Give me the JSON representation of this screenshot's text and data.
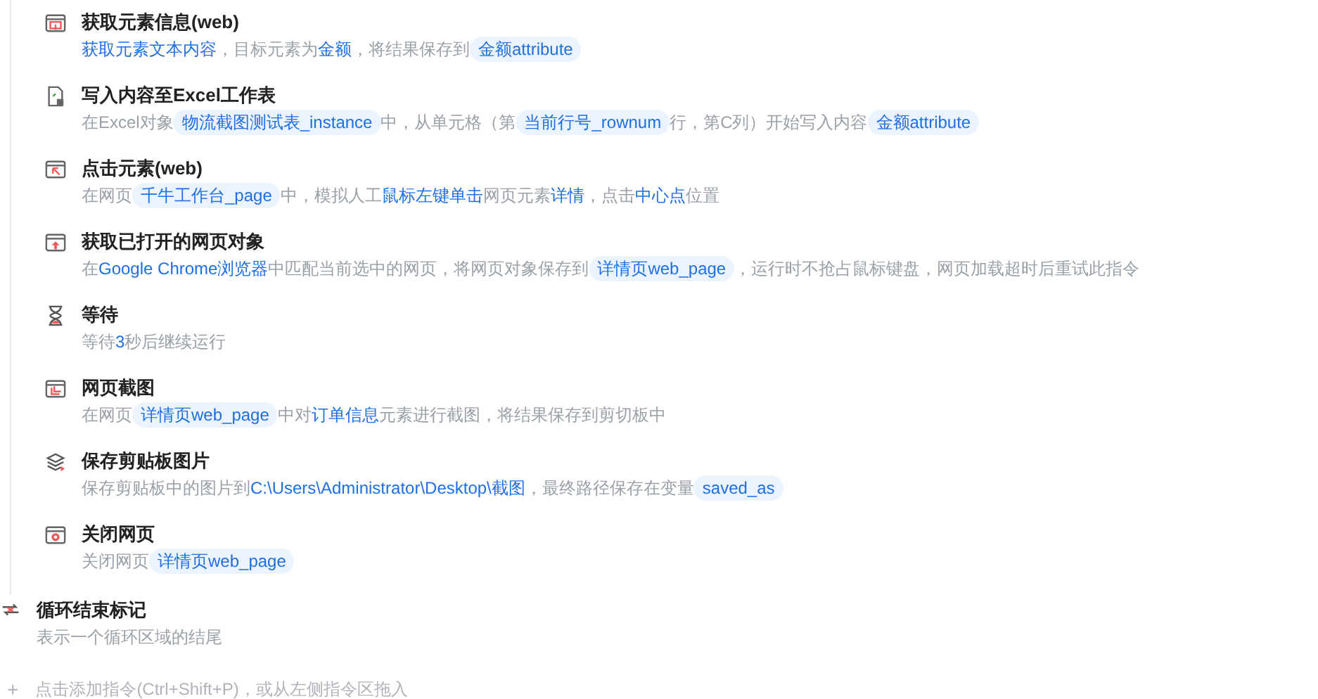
{
  "steps": [
    {
      "kind": "get-element",
      "title": "获取元素信息(web)",
      "description": [
        {
          "kind": "link",
          "text": "获取元素文本内容"
        },
        {
          "kind": "text",
          "text": "，目标元素为"
        },
        {
          "kind": "link",
          "text": "金额"
        },
        {
          "kind": "text",
          "text": "，将结果保存到"
        },
        {
          "kind": "chip",
          "text": "金额attribute"
        }
      ]
    },
    {
      "kind": "write-excel",
      "title": "写入内容至Excel工作表",
      "description": [
        {
          "kind": "text",
          "text": "在Excel对象"
        },
        {
          "kind": "chip",
          "text": "物流截图测试表_instance"
        },
        {
          "kind": "text",
          "text": "中，从单元格（第"
        },
        {
          "kind": "chip",
          "text": "当前行号_rownum"
        },
        {
          "kind": "text",
          "text": "行，第C列）开始写入内容"
        },
        {
          "kind": "chip",
          "text": "金额attribute"
        }
      ]
    },
    {
      "kind": "click-element",
      "title": "点击元素(web)",
      "description": [
        {
          "kind": "text",
          "text": "在网页"
        },
        {
          "kind": "chip",
          "text": "千牛工作台_page"
        },
        {
          "kind": "text",
          "text": "中，模拟人工"
        },
        {
          "kind": "link",
          "text": "鼠标左键单击"
        },
        {
          "kind": "text",
          "text": "网页元素"
        },
        {
          "kind": "link",
          "text": "详情"
        },
        {
          "kind": "text",
          "text": "，点击"
        },
        {
          "kind": "link",
          "text": "中心点"
        },
        {
          "kind": "text",
          "text": "位置"
        }
      ]
    },
    {
      "kind": "get-page",
      "title": "获取已打开的网页对象",
      "description": [
        {
          "kind": "text",
          "text": "在"
        },
        {
          "kind": "link",
          "text": "Google Chrome浏览器"
        },
        {
          "kind": "text",
          "text": "中匹配当前选中的网页，将网页对象保存到"
        },
        {
          "kind": "chip",
          "text": "详情页web_page"
        },
        {
          "kind": "text",
          "text": "，运行时不抢占鼠标键盘，网页加载超时后重试此指令"
        }
      ]
    },
    {
      "kind": "wait",
      "title": "等待",
      "description": [
        {
          "kind": "text",
          "text": "等待"
        },
        {
          "kind": "link",
          "text": "3"
        },
        {
          "kind": "text",
          "text": "秒后继续运行"
        }
      ]
    },
    {
      "kind": "screenshot",
      "title": "网页截图",
      "description": [
        {
          "kind": "text",
          "text": "在网页"
        },
        {
          "kind": "chip",
          "text": "详情页web_page"
        },
        {
          "kind": "text",
          "text": "中对"
        },
        {
          "kind": "link",
          "text": "订单信息"
        },
        {
          "kind": "text",
          "text": "元素进行截图，将结果保存到剪切板中"
        }
      ]
    },
    {
      "kind": "save-image",
      "title": "保存剪贴板图片",
      "description": [
        {
          "kind": "text",
          "text": "保存剪贴板中的图片到 "
        },
        {
          "kind": "link",
          "text": "C:\\Users\\Administrator\\Desktop\\截图"
        },
        {
          "kind": "text",
          "text": "，最终路径保存在变量"
        },
        {
          "kind": "chip",
          "text": "saved_as"
        }
      ]
    },
    {
      "kind": "close-page",
      "title": "关闭网页",
      "description": [
        {
          "kind": "text",
          "text": "关闭网页"
        },
        {
          "kind": "chip",
          "text": "详情页web_page"
        }
      ]
    }
  ],
  "loop_end": {
    "title": "循环结束标记",
    "description": "表示一个循环区域的结尾"
  },
  "add_hint": {
    "icon": "+",
    "text": "点击添加指令(Ctrl+Shift+P)，或从左侧指令区拖入"
  }
}
